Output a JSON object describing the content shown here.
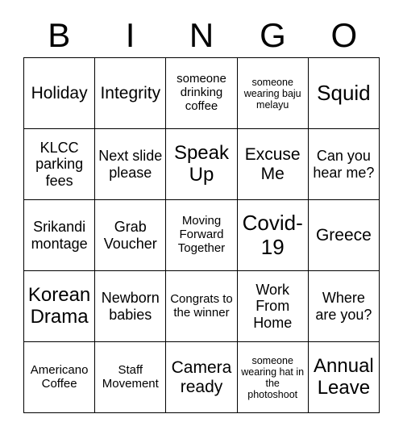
{
  "card": {
    "header_letters": [
      "B",
      "I",
      "N",
      "G",
      "O"
    ],
    "colors": {
      "background": "#ffffff",
      "text": "#000000",
      "border": "#000000"
    },
    "grid": {
      "rows": 5,
      "columns": 5,
      "cells": [
        [
          {
            "text": "Holiday",
            "size": "lg"
          },
          {
            "text": "Integrity",
            "size": "lg"
          },
          {
            "text": "someone drinking coffee",
            "size": "sm"
          },
          {
            "text": "someone wearing baju melayu",
            "size": "xs"
          },
          {
            "text": "Squid",
            "size": "xxl"
          }
        ],
        [
          {
            "text": "KLCC parking fees",
            "size": "md"
          },
          {
            "text": "Next slide please",
            "size": "md"
          },
          {
            "text": "Speak Up",
            "size": "xl"
          },
          {
            "text": "Excuse Me",
            "size": "lg"
          },
          {
            "text": "Can you hear me?",
            "size": "md"
          }
        ],
        [
          {
            "text": "Srikandi montage",
            "size": "md"
          },
          {
            "text": "Grab Voucher",
            "size": "md"
          },
          {
            "text": "Moving Forward Together",
            "size": "sm"
          },
          {
            "text": "Covid-19",
            "size": "xxl"
          },
          {
            "text": "Greece",
            "size": "lg"
          }
        ],
        [
          {
            "text": "Korean Drama",
            "size": "xl"
          },
          {
            "text": "Newborn babies",
            "size": "md"
          },
          {
            "text": "Congrats to the winner",
            "size": "sm"
          },
          {
            "text": "Work From Home",
            "size": "md"
          },
          {
            "text": "Where are you?",
            "size": "md"
          }
        ],
        [
          {
            "text": "Americano Coffee",
            "size": "sm"
          },
          {
            "text": "Staff Movement",
            "size": "sm"
          },
          {
            "text": "Camera ready",
            "size": "lg"
          },
          {
            "text": "someone wearing hat in the photoshoot",
            "size": "xs"
          },
          {
            "text": "Annual Leave",
            "size": "xl"
          }
        ]
      ]
    }
  }
}
